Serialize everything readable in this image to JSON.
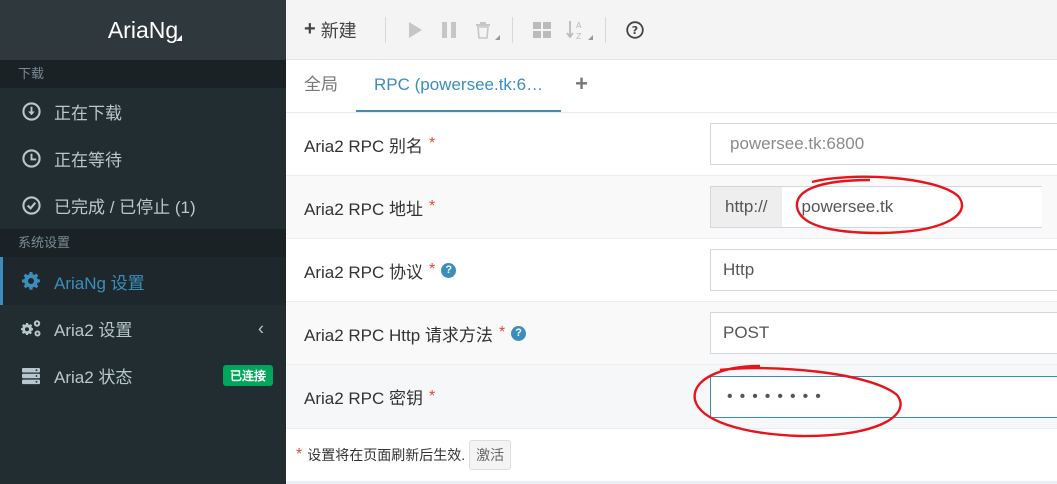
{
  "app": {
    "title": "AriaNg"
  },
  "sidebar": {
    "section_download": "下载",
    "section_settings": "系统设置",
    "items": [
      {
        "label": "正在下载",
        "icon": "download-icon"
      },
      {
        "label": "正在等待",
        "icon": "clock-icon"
      },
      {
        "label": "已完成 / 已停止 (1)",
        "icon": "check-circle-icon"
      },
      {
        "label": "AriaNg 设置",
        "icon": "gear-icon",
        "active": true
      },
      {
        "label": "Aria2 设置",
        "icon": "gears-icon"
      },
      {
        "label": "Aria2 状态",
        "icon": "server-icon",
        "badge": "已连接"
      }
    ],
    "chevron": "‹"
  },
  "toolbar": {
    "new_label": "新建",
    "new_plus": "+"
  },
  "tabs": {
    "global": "全局",
    "rpc": "RPC (powersee.tk:6…",
    "add": "+"
  },
  "form": {
    "rows": [
      {
        "label": "Aria2 RPC 别名",
        "required": "*",
        "value": "powersee.tk:6800"
      },
      {
        "label": "Aria2 RPC 地址",
        "required": "*",
        "prefix": "http://",
        "value": "powersee.tk"
      },
      {
        "label": "Aria2 RPC 协议",
        "required": "*",
        "help": "?",
        "value": "Http"
      },
      {
        "label": "Aria2 RPC Http 请求方法",
        "required": "*",
        "help": "?",
        "value": "POST"
      },
      {
        "label": "Aria2 RPC 密钥",
        "required": "*",
        "value": "••••••••"
      }
    ]
  },
  "footnote": {
    "marker": "*",
    "text": "设置将在页面刷新后生效.",
    "button": "激活"
  },
  "colors": {
    "accent": "#3c8dbc",
    "sidebar_bg": "#222d32",
    "badge_green": "#00a65a",
    "required_red": "#dd4b39",
    "annotation_red": "#e8141c"
  }
}
